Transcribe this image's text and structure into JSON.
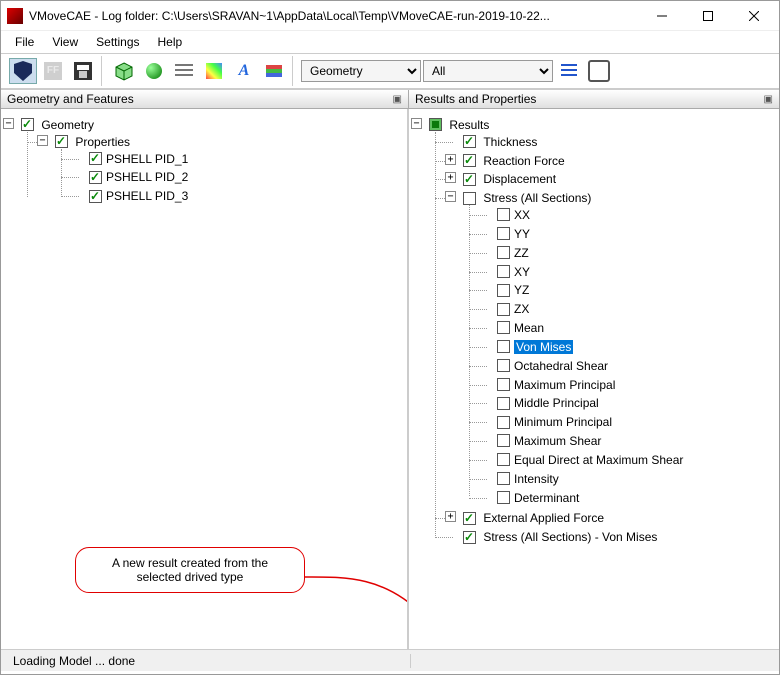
{
  "window": {
    "title": "VMoveCAE - Log folder: C:\\Users\\SRAVAN~1\\AppData\\Local\\Temp\\VMoveCAE-run-2019-10-22..."
  },
  "menu": {
    "file": "File",
    "view": "View",
    "settings": "Settings",
    "help": "Help"
  },
  "toolbar": {
    "geometry_combo": "Geometry",
    "filter_combo": "All"
  },
  "panels": {
    "left_title": "Geometry and Features",
    "right_title": "Results and Properties"
  },
  "left_tree": {
    "root": "Geometry",
    "properties": "Properties",
    "items": [
      "PSHELL PID_1",
      "PSHELL PID_2",
      "PSHELL PID_3"
    ]
  },
  "right_tree": {
    "root": "Results",
    "thickness": "Thickness",
    "reaction_force": "Reaction Force",
    "displacement": "Displacement",
    "stress_all": "Stress (All Sections)",
    "stress_children": [
      "XX",
      "YY",
      "ZZ",
      "XY",
      "YZ",
      "ZX",
      "Mean",
      "Von Mises",
      "Octahedral Shear",
      "Maximum Principal",
      "Middle Principal",
      "Minimum Principal",
      "Maximum Shear",
      "Equal Direct at Maximum Shear",
      "Intensity",
      "Determinant"
    ],
    "selected_index": 7,
    "external_force": "External Applied Force",
    "stress_vonmises": "Stress (All Sections) - Von Mises"
  },
  "annotation": {
    "text_line1": "A new result created from the",
    "text_line2": "selected drived type"
  },
  "status": {
    "text": "Loading Model ... done"
  }
}
